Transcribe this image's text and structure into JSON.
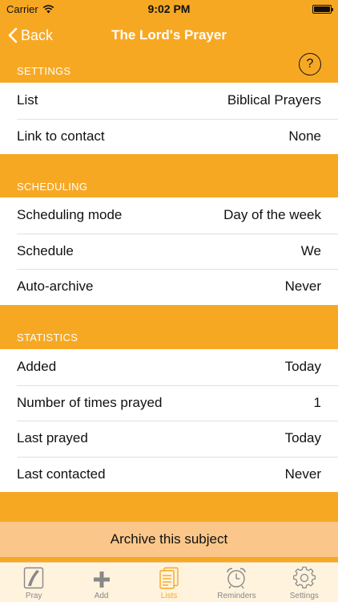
{
  "status": {
    "carrier": "Carrier",
    "time": "9:02 PM"
  },
  "nav": {
    "back_label": "Back",
    "title": "The Lord's Prayer"
  },
  "help": {
    "label": "?"
  },
  "sections": {
    "settings": {
      "header": "SETTINGS",
      "rows": [
        {
          "label": "List",
          "value": "Biblical Prayers"
        },
        {
          "label": "Link to contact",
          "value": "None"
        }
      ]
    },
    "scheduling": {
      "header": "SCHEDULING",
      "rows": [
        {
          "label": "Scheduling mode",
          "value": "Day of the week"
        },
        {
          "label": "Schedule",
          "value": "We"
        },
        {
          "label": "Auto-archive",
          "value": "Never"
        }
      ]
    },
    "statistics": {
      "header": "STATISTICS",
      "rows": [
        {
          "label": "Added",
          "value": "Today"
        },
        {
          "label": "Number of times prayed",
          "value": "1"
        },
        {
          "label": "Last prayed",
          "value": "Today"
        },
        {
          "label": "Last contacted",
          "value": "Never"
        }
      ]
    }
  },
  "archive": {
    "label": "Archive this subject"
  },
  "tabs": [
    {
      "label": "Pray",
      "icon": "pray-icon"
    },
    {
      "label": "Add",
      "icon": "plus-icon"
    },
    {
      "label": "Lists",
      "icon": "lists-icon",
      "active": true
    },
    {
      "label": "Reminders",
      "icon": "alarm-clock-icon"
    },
    {
      "label": "Settings",
      "icon": "gear-icon"
    }
  ],
  "colors": {
    "accent": "#F7A823",
    "archive_bg": "#FAC68A",
    "tab_bar_bg": "#FFF3DE"
  }
}
